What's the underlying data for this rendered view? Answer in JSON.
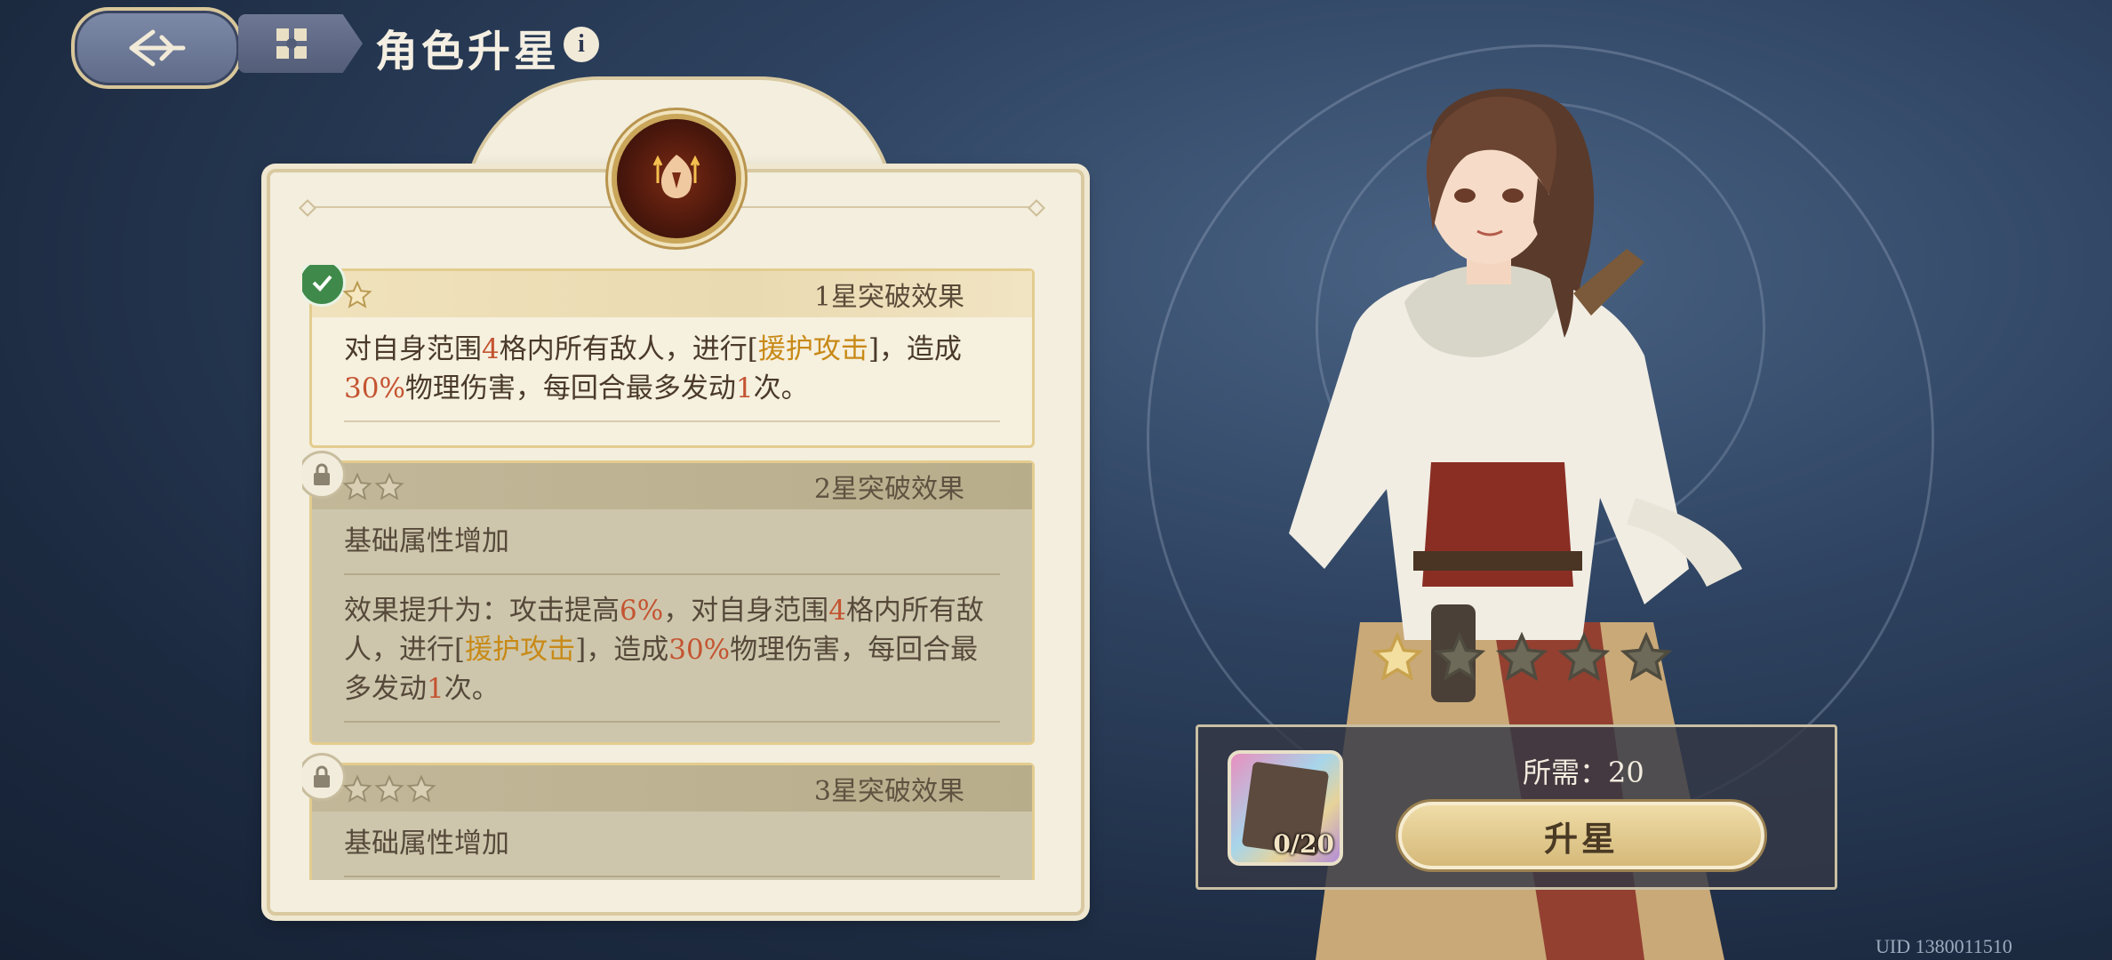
{
  "header": {
    "title": "角色升星",
    "info_glyph": "i"
  },
  "breakthroughs": [
    {
      "title": "1星突破效果",
      "stars": 1,
      "state": "unlocked",
      "lines": [
        [
          "对自身范围",
          "4",
          "格内所有敌人，进行[",
          "援护攻击",
          "]，造成"
        ],
        [
          "30%",
          "物理伤害，每回合最多发动",
          "1",
          "次。"
        ]
      ]
    },
    {
      "title": "2星突破效果",
      "stars": 2,
      "state": "locked",
      "base_text": "基础属性增加",
      "lines": [
        [
          "效果提升为：攻击提高",
          "6%",
          "，对自身范围",
          "4",
          "格内所有敌"
        ],
        [
          "人，进行[",
          "援护攻击",
          "]，造成",
          "30%",
          "物理伤害，每回合最"
        ],
        [
          "多发动",
          "1",
          "次。"
        ]
      ]
    },
    {
      "title": "3星突破效果",
      "stars": 3,
      "state": "locked",
      "base_text": "基础属性增加"
    }
  ],
  "rank": {
    "current": 1,
    "max": 5
  },
  "cost": {
    "label": "所需：20",
    "shard_count": "0/20",
    "button_label": "升星"
  },
  "uid": "UID 1380011510",
  "colors": {
    "highlight_red": "#c45431",
    "highlight_gold": "#c88a17",
    "card_bg": "#f3eedd",
    "button_gold": "#d5b979"
  }
}
